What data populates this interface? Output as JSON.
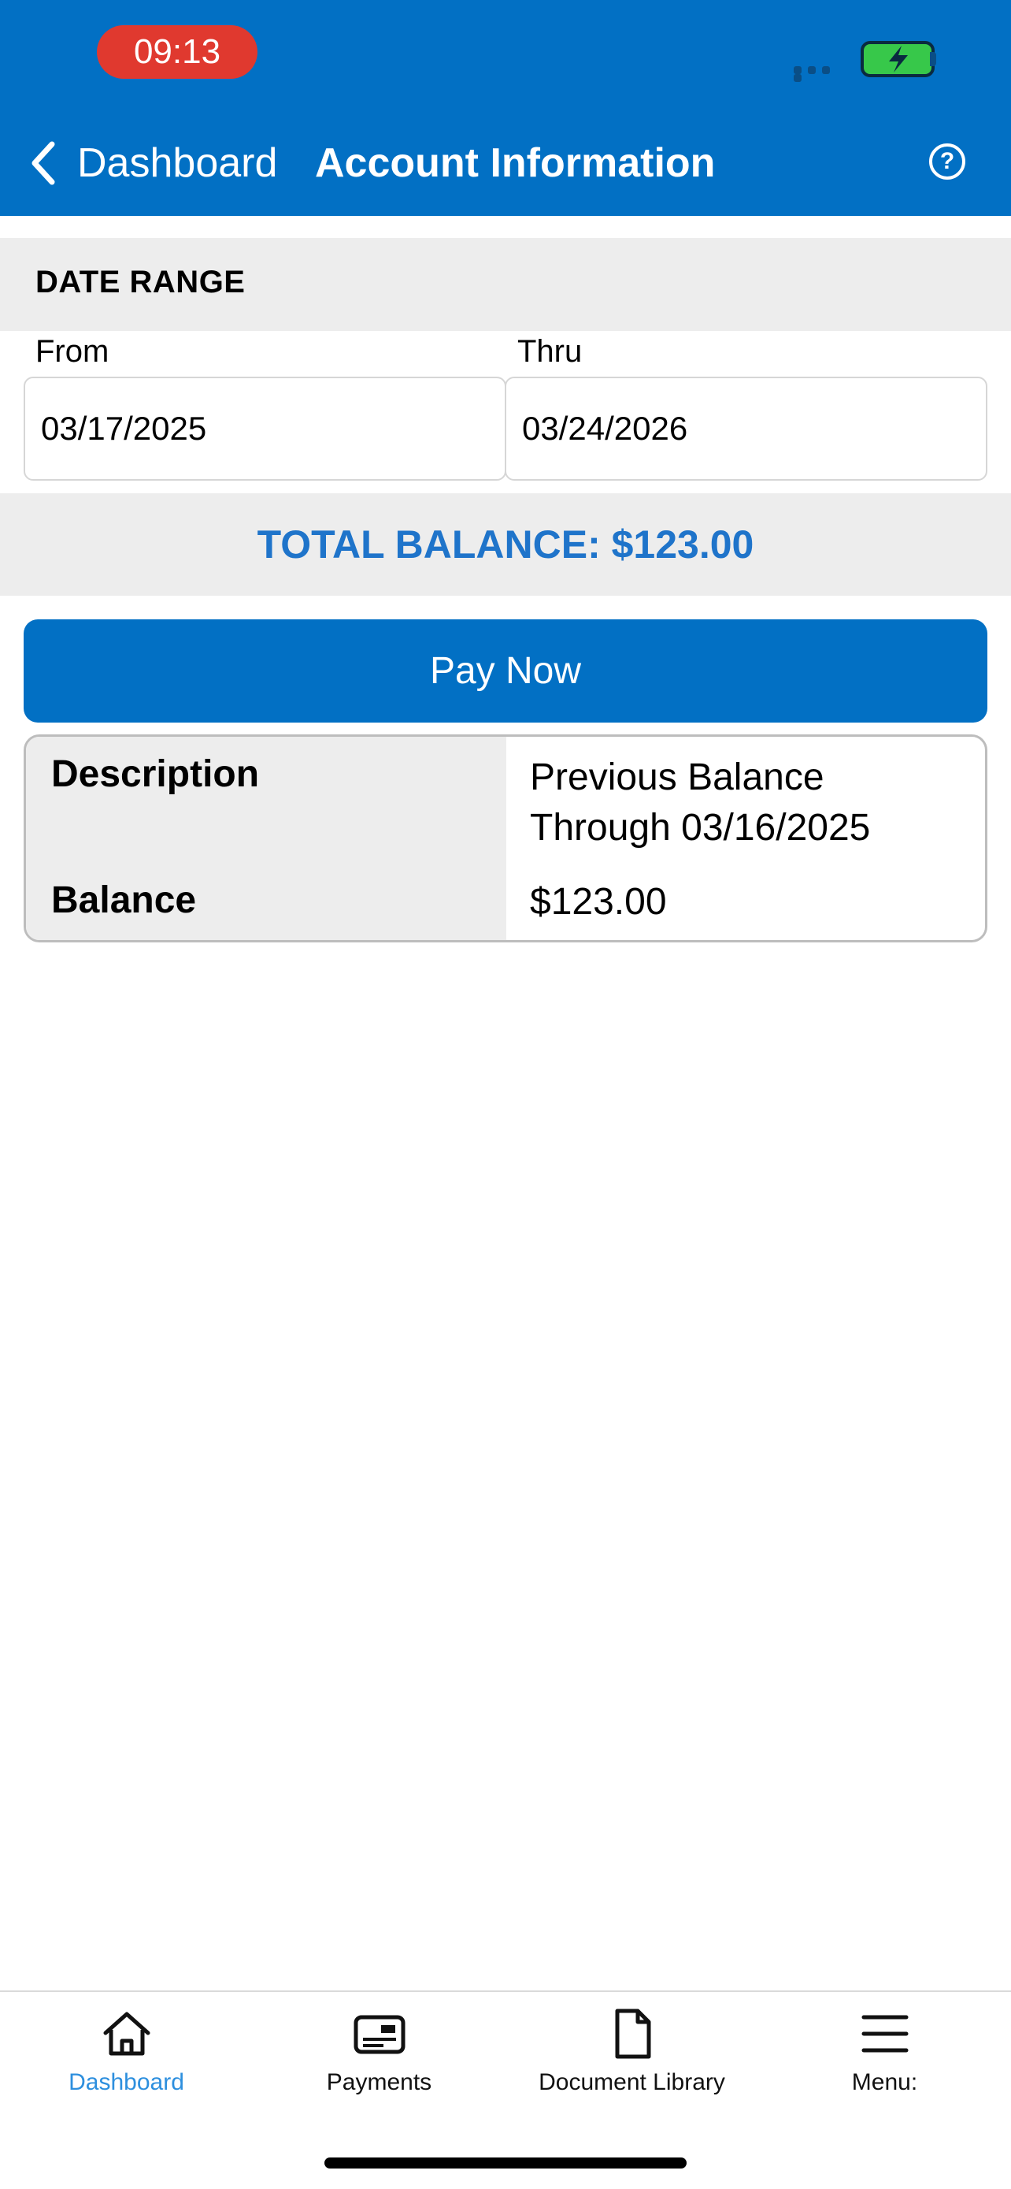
{
  "status_bar": {
    "time": "09:13"
  },
  "header": {
    "back_label": "Dashboard",
    "title": "Account Information",
    "help_glyph": "?"
  },
  "date_range": {
    "section_title": "DATE RANGE",
    "from_label": "From",
    "from_value": "03/17/2025",
    "thru_label": "Thru",
    "thru_value": "03/24/2026"
  },
  "total_balance": "TOTAL BALANCE: $123.00",
  "pay_now_label": "Pay Now",
  "detail": {
    "description_label": "Description",
    "description_line1": "Previous Balance",
    "description_line2": "Through 03/16/2025",
    "balance_label": "Balance",
    "balance_value": "$123.00"
  },
  "tabs": [
    {
      "label": "Dashboard",
      "icon": "home-icon",
      "active": true
    },
    {
      "label": "Payments",
      "icon": "payments-icon",
      "active": false
    },
    {
      "label": "Document Library",
      "icon": "document-icon",
      "active": false
    },
    {
      "label": "Menu:",
      "icon": "menu-icon",
      "active": false
    }
  ],
  "colors": {
    "brand_blue": "#0270C4",
    "total_text": "#1F74CA",
    "active_tab": "#2D8FDE",
    "time_pill": "#E0392F",
    "battery": "#37C84A"
  }
}
